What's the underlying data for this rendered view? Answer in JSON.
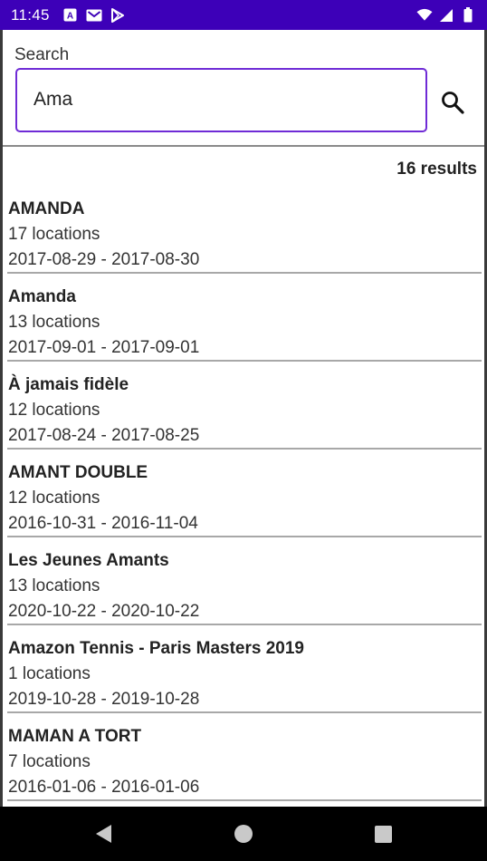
{
  "status_bar": {
    "time": "11:45",
    "notification_icons": [
      "a-icon",
      "gmail-icon",
      "play-store-icon"
    ],
    "system_icons": [
      "wifi-icon",
      "signal-icon",
      "battery-icon"
    ]
  },
  "search": {
    "label": "Search",
    "value": "Ama",
    "button_icon": "search-icon",
    "accent_color": "#6f2bd6"
  },
  "results": {
    "count_text": "16 results",
    "items": [
      {
        "title": "AMANDA",
        "locations": "17 locations",
        "dates": "2017-08-29 - 2017-08-30"
      },
      {
        "title": "Amanda",
        "locations": "13 locations",
        "dates": "2017-09-01 - 2017-09-01"
      },
      {
        "title": "À jamais fidèle",
        "locations": "12 locations",
        "dates": "2017-08-24 - 2017-08-25"
      },
      {
        "title": "AMANT DOUBLE",
        "locations": "12 locations",
        "dates": "2016-10-31 - 2016-11-04"
      },
      {
        "title": "Les Jeunes Amants",
        "locations": "13 locations",
        "dates": "2020-10-22 - 2020-10-22"
      },
      {
        "title": "Amazon Tennis - Paris Masters 2019",
        "locations": "1 locations",
        "dates": "2019-10-28 - 2019-10-28"
      },
      {
        "title": "MAMAN A TORT",
        "locations": "7 locations",
        "dates": "2016-01-06 - 2016-01-06"
      }
    ]
  },
  "colors": {
    "status_bar": "#3d00b8",
    "nav_bar": "#000000"
  }
}
